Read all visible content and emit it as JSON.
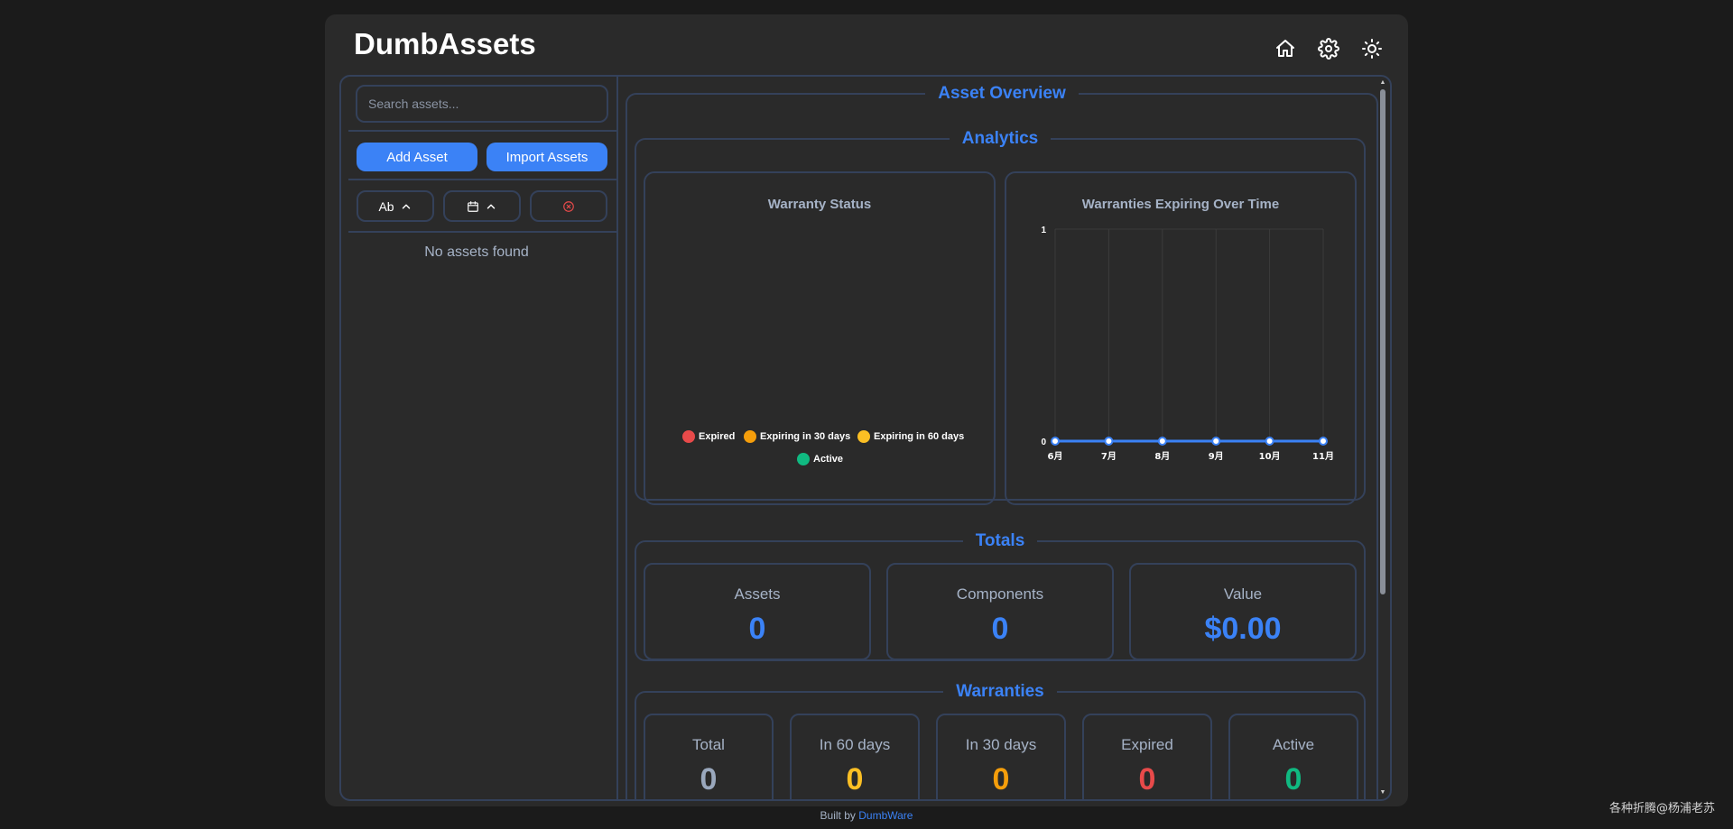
{
  "app": {
    "title": "DumbAssets"
  },
  "header": {
    "icons": [
      "home-icon",
      "gear-icon",
      "sun-icon"
    ]
  },
  "sidebar": {
    "search_placeholder": "Search assets...",
    "add_asset": "Add Asset",
    "import_assets": "Import Assets",
    "sort_name": "Ab",
    "empty_message": "No assets found"
  },
  "overview": {
    "title": "Asset Overview",
    "analytics": {
      "title": "Analytics",
      "warranty_status_title": "Warranty Status",
      "legend": [
        {
          "label": "Expired",
          "color": "#e84a4a"
        },
        {
          "label": "Expiring in 30 days",
          "color": "#f59e0b"
        },
        {
          "label": "Expiring in 60 days",
          "color": "#fbbf24"
        },
        {
          "label": "Active",
          "color": "#10b981"
        }
      ],
      "expiring_title": "Warranties Expiring Over Time"
    },
    "totals": {
      "title": "Totals",
      "items": [
        {
          "label": "Assets",
          "value": "0"
        },
        {
          "label": "Components",
          "value": "0"
        },
        {
          "label": "Value",
          "value": "$0.00"
        }
      ]
    },
    "warranties": {
      "title": "Warranties",
      "items": [
        {
          "label": "Total",
          "value": "0",
          "color": "#9aa8bd"
        },
        {
          "label": "In 60 days",
          "value": "0",
          "color": "#fbbf24"
        },
        {
          "label": "In 30 days",
          "value": "0",
          "color": "#f59e0b"
        },
        {
          "label": "Expired",
          "value": "0",
          "color": "#e84a4a"
        },
        {
          "label": "Active",
          "value": "0",
          "color": "#10b981"
        }
      ]
    }
  },
  "chart_data": {
    "type": "line",
    "title": "Warranties Expiring Over Time",
    "categories": [
      "6月",
      "7月",
      "8月",
      "9月",
      "10月",
      "11月"
    ],
    "series": [
      {
        "values": [
          0,
          0,
          0,
          0,
          0,
          0
        ]
      }
    ],
    "ylim": [
      0,
      1
    ],
    "yticks": [
      "0",
      "1"
    ],
    "grid": true,
    "color": "#3b82f6"
  },
  "footer": {
    "prefix": "Built by",
    "link": "DumbWare"
  },
  "watermark": "各种折腾@杨浦老苏"
}
